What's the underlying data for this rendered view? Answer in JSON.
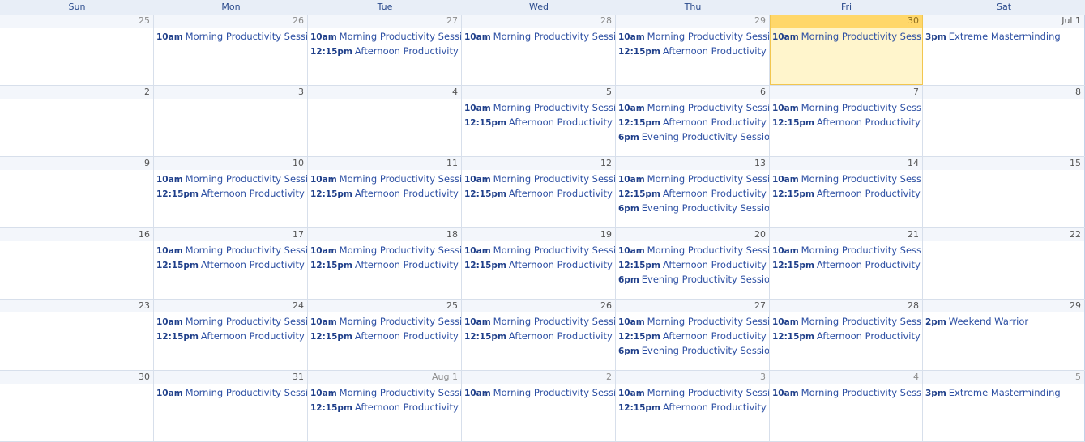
{
  "weekdays": [
    "Sun",
    "Mon",
    "Tue",
    "Wed",
    "Thu",
    "Fri",
    "Sat"
  ],
  "weeks": [
    [
      {
        "label": "25",
        "other": true,
        "events": []
      },
      {
        "label": "26",
        "other": true,
        "events": [
          {
            "time": "10am",
            "title": "Morning Productivity Session"
          }
        ]
      },
      {
        "label": "27",
        "other": true,
        "events": [
          {
            "time": "10am",
            "title": "Morning Productivity Session"
          },
          {
            "time": "12:15pm",
            "title": "Afternoon Productivity Session"
          }
        ]
      },
      {
        "label": "28",
        "other": true,
        "events": [
          {
            "time": "10am",
            "title": "Morning Productivity Session"
          }
        ]
      },
      {
        "label": "29",
        "other": true,
        "events": [
          {
            "time": "10am",
            "title": "Morning Productivity Session"
          },
          {
            "time": "12:15pm",
            "title": "Afternoon Productivity"
          }
        ]
      },
      {
        "label": "30",
        "other": true,
        "today": true,
        "events": [
          {
            "time": "10am",
            "title": "Morning Productivity Session"
          }
        ]
      },
      {
        "label": "Jul 1",
        "events": [
          {
            "time": "3pm",
            "title": "Extreme Masterminding"
          }
        ]
      }
    ],
    [
      {
        "label": "2",
        "events": []
      },
      {
        "label": "3",
        "events": []
      },
      {
        "label": "4",
        "events": []
      },
      {
        "label": "5",
        "events": [
          {
            "time": "10am",
            "title": "Morning Productivity Session"
          },
          {
            "time": "12:15pm",
            "title": "Afternoon Productivity Session"
          }
        ]
      },
      {
        "label": "6",
        "events": [
          {
            "time": "10am",
            "title": "Morning Productivity Session"
          },
          {
            "time": "12:15pm",
            "title": "Afternoon Productivity"
          },
          {
            "time": "6pm",
            "title": "Evening Productivity Session"
          }
        ]
      },
      {
        "label": "7",
        "events": [
          {
            "time": "10am",
            "title": "Morning Productivity Session"
          },
          {
            "time": "12:15pm",
            "title": "Afternoon Productivity Session"
          }
        ]
      },
      {
        "label": "8",
        "events": []
      }
    ],
    [
      {
        "label": "9",
        "events": []
      },
      {
        "label": "10",
        "events": [
          {
            "time": "10am",
            "title": "Morning Productivity Session"
          },
          {
            "time": "12:15pm",
            "title": "Afternoon Productivity Session"
          }
        ]
      },
      {
        "label": "11",
        "events": [
          {
            "time": "10am",
            "title": "Morning Productivity Session"
          },
          {
            "time": "12:15pm",
            "title": "Afternoon Productivity Session"
          }
        ]
      },
      {
        "label": "12",
        "events": [
          {
            "time": "10am",
            "title": "Morning Productivity Session"
          },
          {
            "time": "12:15pm",
            "title": "Afternoon Productivity Session"
          }
        ]
      },
      {
        "label": "13",
        "events": [
          {
            "time": "10am",
            "title": "Morning Productivity Session"
          },
          {
            "time": "12:15pm",
            "title": "Afternoon Productivity"
          },
          {
            "time": "6pm",
            "title": "Evening Productivity Session"
          }
        ]
      },
      {
        "label": "14",
        "events": [
          {
            "time": "10am",
            "title": "Morning Productivity Session"
          },
          {
            "time": "12:15pm",
            "title": "Afternoon Productivity Session"
          }
        ]
      },
      {
        "label": "15",
        "events": []
      }
    ],
    [
      {
        "label": "16",
        "events": []
      },
      {
        "label": "17",
        "events": [
          {
            "time": "10am",
            "title": "Morning Productivity Session"
          },
          {
            "time": "12:15pm",
            "title": "Afternoon Productivity Session"
          }
        ]
      },
      {
        "label": "18",
        "events": [
          {
            "time": "10am",
            "title": "Morning Productivity Session"
          },
          {
            "time": "12:15pm",
            "title": "Afternoon Productivity Session"
          }
        ]
      },
      {
        "label": "19",
        "events": [
          {
            "time": "10am",
            "title": "Morning Productivity Session"
          },
          {
            "time": "12:15pm",
            "title": "Afternoon Productivity Session"
          }
        ]
      },
      {
        "label": "20",
        "events": [
          {
            "time": "10am",
            "title": "Morning Productivity Session"
          },
          {
            "time": "12:15pm",
            "title": "Afternoon Productivity"
          },
          {
            "time": "6pm",
            "title": "Evening Productivity Session"
          }
        ]
      },
      {
        "label": "21",
        "events": [
          {
            "time": "10am",
            "title": "Morning Productivity Session"
          },
          {
            "time": "12:15pm",
            "title": "Afternoon Productivity Session"
          }
        ]
      },
      {
        "label": "22",
        "events": []
      }
    ],
    [
      {
        "label": "23",
        "events": []
      },
      {
        "label": "24",
        "events": [
          {
            "time": "10am",
            "title": "Morning Productivity Session"
          },
          {
            "time": "12:15pm",
            "title": "Afternoon Productivity Session"
          }
        ]
      },
      {
        "label": "25",
        "events": [
          {
            "time": "10am",
            "title": "Morning Productivity Session"
          },
          {
            "time": "12:15pm",
            "title": "Afternoon Productivity Session"
          }
        ]
      },
      {
        "label": "26",
        "events": [
          {
            "time": "10am",
            "title": "Morning Productivity Session"
          },
          {
            "time": "12:15pm",
            "title": "Afternoon Productivity Session"
          }
        ]
      },
      {
        "label": "27",
        "events": [
          {
            "time": "10am",
            "title": "Morning Productivity Session"
          },
          {
            "time": "12:15pm",
            "title": "Afternoon Productivity"
          },
          {
            "time": "6pm",
            "title": "Evening Productivity Session"
          }
        ]
      },
      {
        "label": "28",
        "events": [
          {
            "time": "10am",
            "title": "Morning Productivity Session"
          },
          {
            "time": "12:15pm",
            "title": "Afternoon Productivity Session"
          }
        ]
      },
      {
        "label": "29",
        "events": [
          {
            "time": "2pm",
            "title": "Weekend Warrior"
          }
        ]
      }
    ],
    [
      {
        "label": "30",
        "events": []
      },
      {
        "label": "31",
        "events": [
          {
            "time": "10am",
            "title": "Morning Productivity Session"
          }
        ]
      },
      {
        "label": "Aug 1",
        "other": true,
        "events": [
          {
            "time": "10am",
            "title": "Morning Productivity Session"
          },
          {
            "time": "12:15pm",
            "title": "Afternoon Productivity Session"
          }
        ]
      },
      {
        "label": "2",
        "other": true,
        "events": [
          {
            "time": "10am",
            "title": "Morning Productivity Session"
          }
        ]
      },
      {
        "label": "3",
        "other": true,
        "events": [
          {
            "time": "10am",
            "title": "Morning Productivity Session"
          },
          {
            "time": "12:15pm",
            "title": "Afternoon Productivity"
          }
        ]
      },
      {
        "label": "4",
        "other": true,
        "events": [
          {
            "time": "10am",
            "title": "Morning Productivity Session"
          }
        ]
      },
      {
        "label": "5",
        "other": true,
        "events": [
          {
            "time": "3pm",
            "title": "Extreme Masterminding"
          }
        ]
      }
    ]
  ]
}
